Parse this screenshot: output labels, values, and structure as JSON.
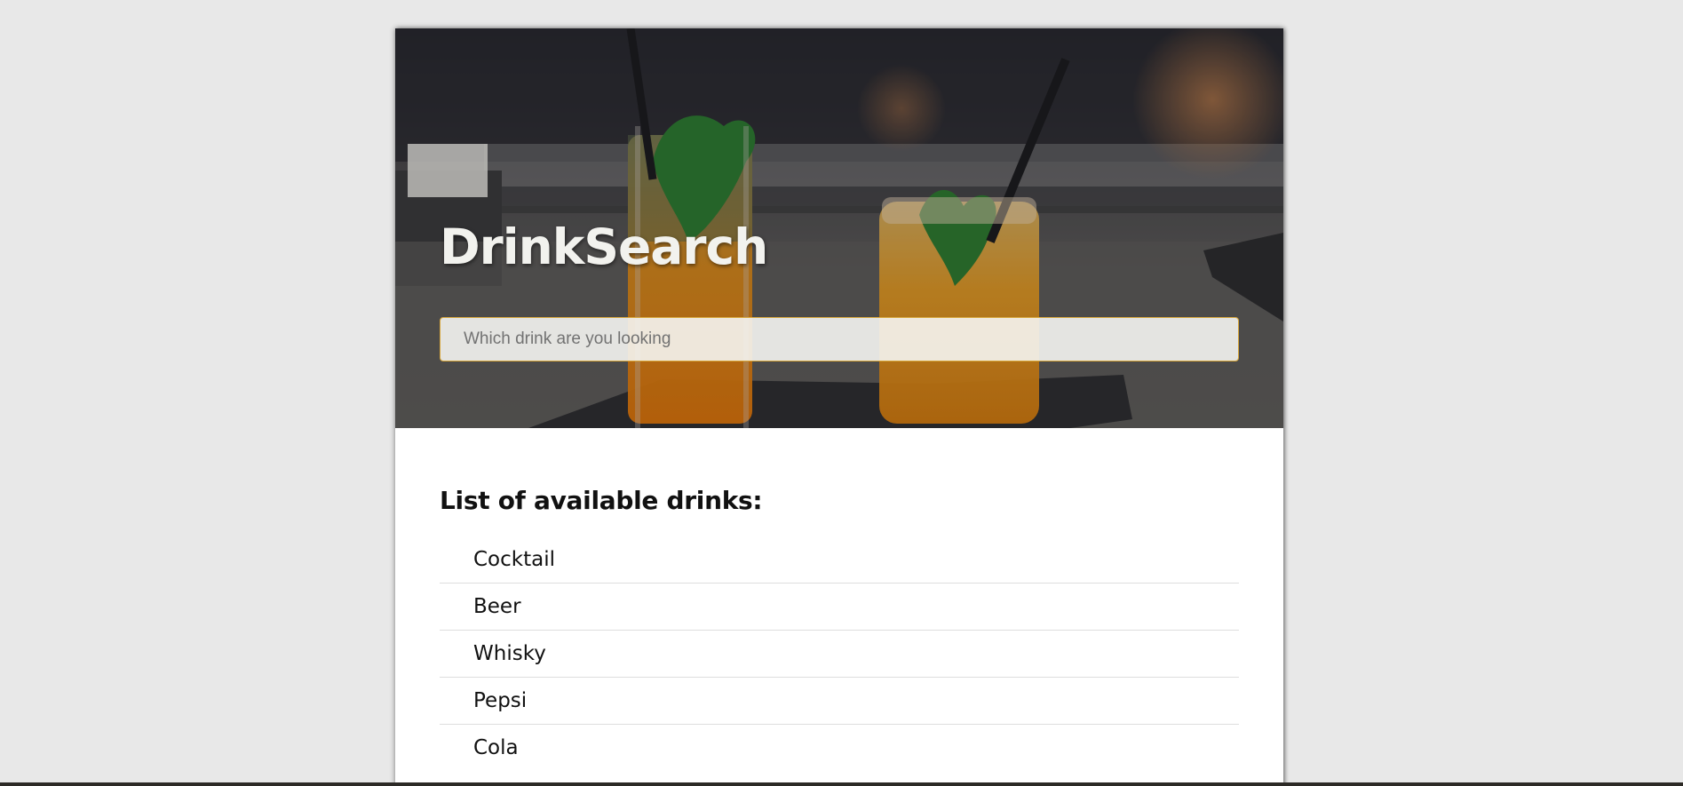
{
  "header": {
    "brand": "DrinkSearch",
    "search_placeholder": "Which drink are you looking"
  },
  "main": {
    "list_title": "List of available drinks:",
    "drinks": [
      "Cocktail",
      "Beer",
      "Whisky",
      "Pepsi",
      "Cola"
    ]
  },
  "colors": {
    "page_background": "#e8e8e8",
    "card_background": "#ffffff",
    "search_border": "#d7a63a"
  }
}
